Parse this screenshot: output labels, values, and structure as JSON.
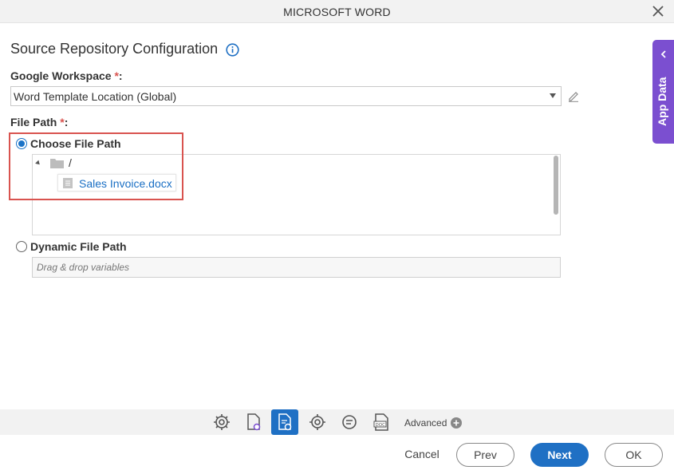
{
  "window": {
    "title": "MICROSOFT WORD"
  },
  "form": {
    "heading": "Source Repository Configuration",
    "workspace": {
      "label": "Google Workspace",
      "required_mark": "*",
      "colon": ":",
      "selected_value": "Word Template Location (Global)"
    },
    "file_path": {
      "label": "File Path",
      "required_mark": "*",
      "colon": ":",
      "choose_option_label": "Choose File Path",
      "tree_root": "/",
      "tree_file": "Sales Invoice.docx",
      "dynamic_option_label": "Dynamic File Path",
      "dynamic_placeholder": "Drag & drop variables"
    }
  },
  "side_panel": {
    "label": "App Data"
  },
  "toolbar": {
    "icons": [
      "settings-gear-icon",
      "document-settings-icon",
      "document-config-icon",
      "gear-icon",
      "settings-list-icon",
      "doc-file-icon"
    ],
    "advanced_label": "Advanced"
  },
  "footer": {
    "cancel_label": "Cancel",
    "prev_label": "Prev",
    "next_label": "Next",
    "ok_label": "OK"
  },
  "colors": {
    "accent": "#1f70c4",
    "side_panel": "#7b4fd0",
    "required": "#d9534f",
    "highlight_border": "#d9534f"
  }
}
